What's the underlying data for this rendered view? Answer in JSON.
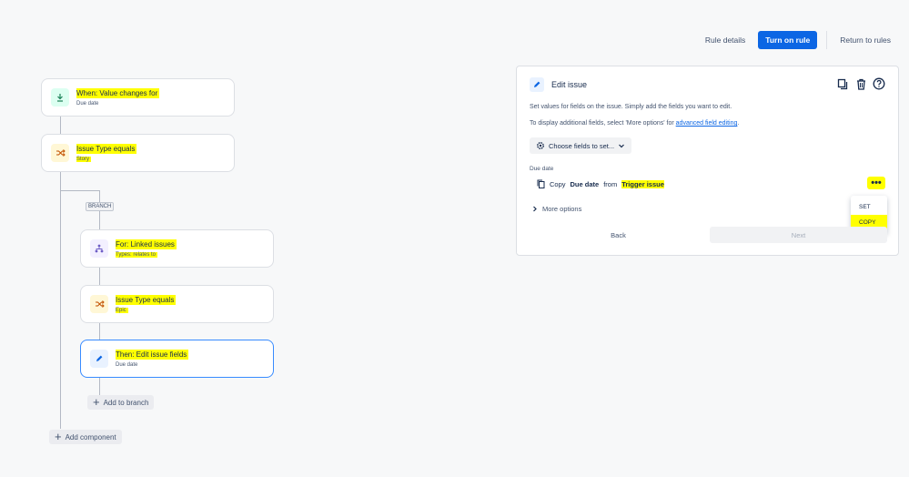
{
  "topbar": {
    "rule_details": "Rule details",
    "turn_on": "Turn on rule",
    "return": "Return to rules"
  },
  "flow": {
    "trigger": {
      "title": "When: Value changes for",
      "sub": "Due date"
    },
    "condition1": {
      "title": "Issue Type equals",
      "sub": "Story"
    },
    "branch_tag": "BRANCH",
    "branch": {
      "title": "For: Linked issues",
      "sub": "Types: relates to"
    },
    "condition2": {
      "title": "Issue Type equals",
      "sub": "Epic"
    },
    "action": {
      "title": "Then: Edit issue fields",
      "sub": "Due date"
    },
    "add_to_branch": "Add to branch",
    "add_component": "Add component"
  },
  "panel": {
    "title": "Edit issue",
    "desc1": "Set values for fields on the issue. Simply add the fields you want to edit.",
    "desc2_prefix": "To display additional fields, select 'More options' for ",
    "desc2_link": "advanced field editing",
    "desc2_suffix": ".",
    "choose_fields": "Choose fields to set...",
    "field_label": "Due date",
    "copy_prefix": "Copy",
    "copy_field": "Due date",
    "copy_from": "from",
    "copy_source": "Trigger issue",
    "menu_set": "SET",
    "menu_copy": "COPY",
    "more_options": "More options",
    "back": "Back",
    "next": "Next"
  },
  "colors": {
    "highlight": "#ffff00",
    "primary": "#0c66e4"
  }
}
